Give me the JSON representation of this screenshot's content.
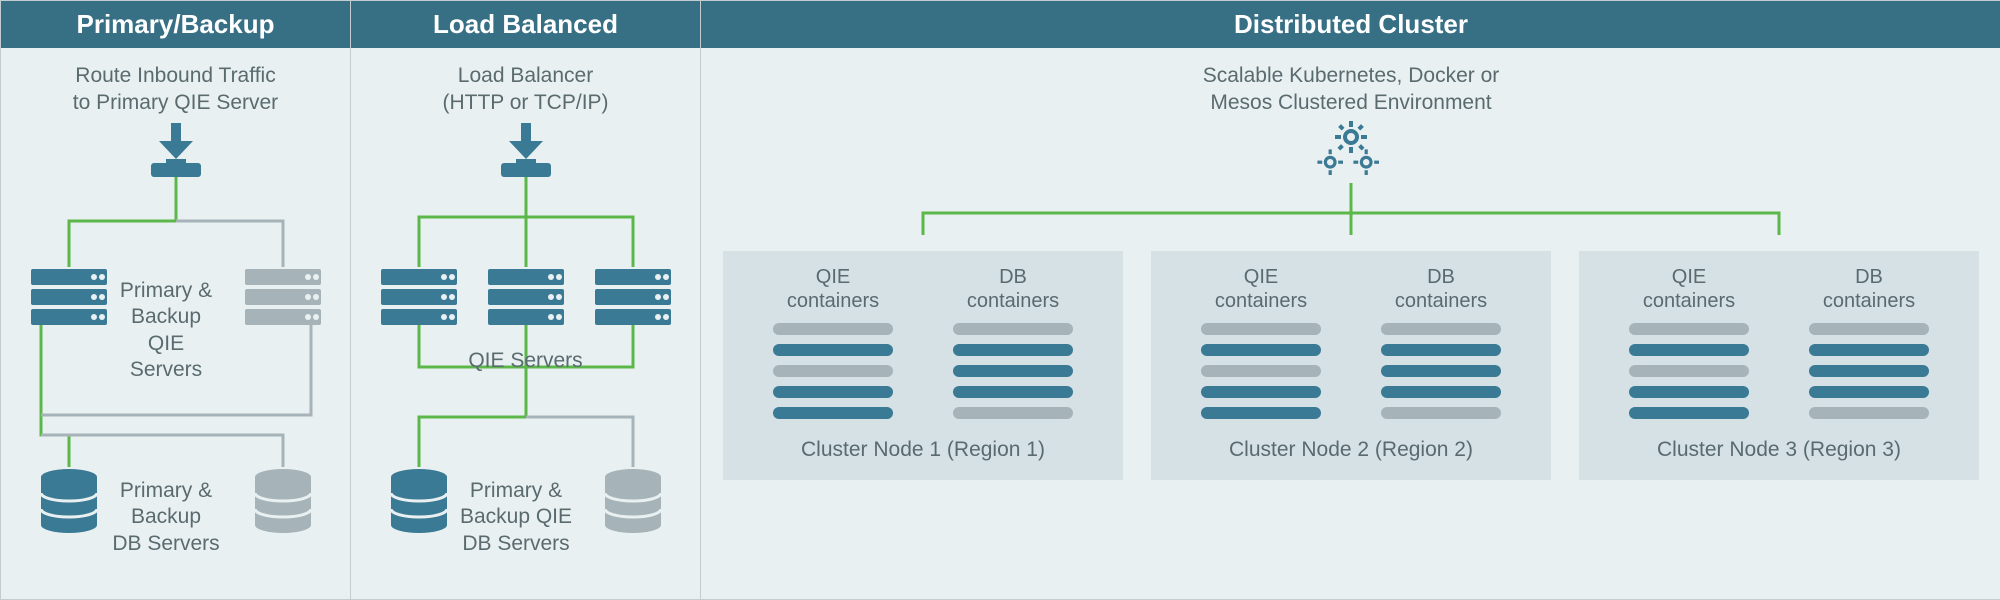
{
  "colors": {
    "teal": "#377085",
    "blue": "#3a7a95",
    "grey": "#a6b3b8",
    "green": "#5bb848"
  },
  "columns": {
    "primary_backup": {
      "header": "Primary/Backup",
      "desc": "Route Inbound Traffic\nto Primary QIE Server",
      "servers_label": "Primary &\nBackup\nQIE Servers",
      "db_label": "Primary &\nBackup\nDB Servers"
    },
    "load_balanced": {
      "header": "Load Balanced",
      "desc": "Load Balancer\n(HTTP or TCP/IP)",
      "servers_label": "QIE Servers",
      "db_label": "Primary &\nBackup QIE\nDB Servers"
    },
    "distributed": {
      "header": "Distributed Cluster",
      "desc": "Scalable Kubernetes, Docker or\nMesos Clustered Environment",
      "container_cols": {
        "qie": "QIE\ncontainers",
        "db": "DB\ncontainers"
      },
      "nodes": [
        {
          "caption": "Cluster Node 1 (Region 1)"
        },
        {
          "caption": "Cluster Node 2 (Region 2)"
        },
        {
          "caption": "Cluster Node 3 (Region 3)"
        }
      ]
    }
  }
}
